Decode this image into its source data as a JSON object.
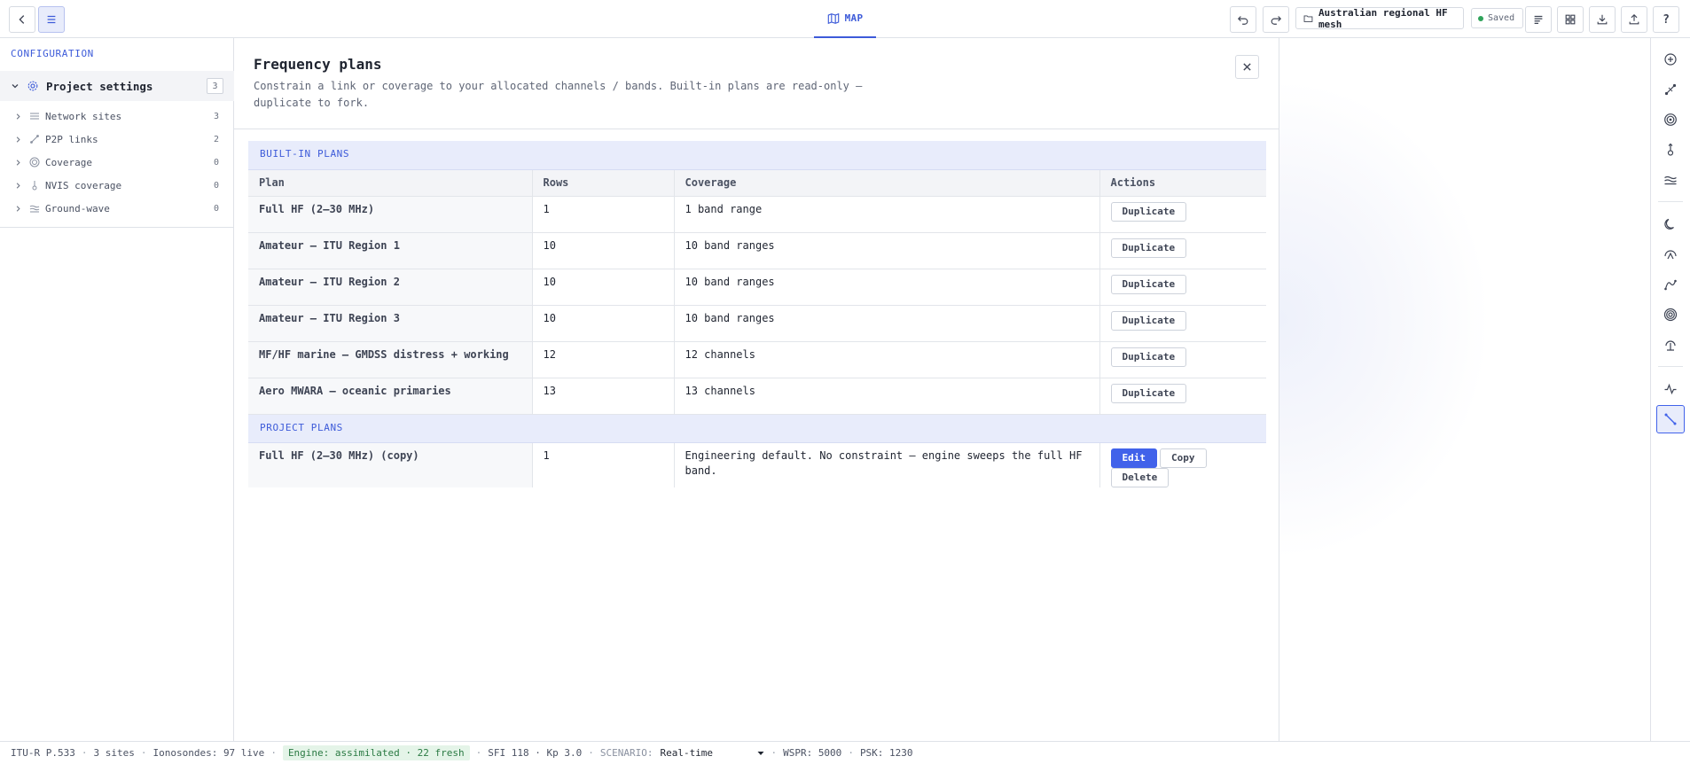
{
  "topbar": {
    "map_tab": "MAP",
    "project_name": "Australian regional HF mesh",
    "saved_status": "Saved",
    "help": "?"
  },
  "sidebar": {
    "title": "CONFIGURATION",
    "project": {
      "label": "Project settings",
      "count": "3"
    },
    "items": [
      {
        "label": "Network sites",
        "count": "3",
        "icon": "network-sites-icon"
      },
      {
        "label": "P2P links",
        "count": "2",
        "icon": "p2p-link-icon"
      },
      {
        "label": "Coverage",
        "count": "0",
        "icon": "coverage-icon"
      },
      {
        "label": "NVIS coverage",
        "count": "0",
        "icon": "nvis-icon"
      },
      {
        "label": "Ground-wave",
        "count": "0",
        "icon": "ground-wave-icon"
      }
    ]
  },
  "panel": {
    "title": "Frequency plans",
    "description": "Constrain a link or coverage to your allocated channels / bands. Built-in plans are read-only — duplicate to fork.",
    "builtin_section": "BUILT-IN PLANS",
    "project_section": "PROJECT PLANS",
    "columns": {
      "plan": "Plan",
      "rows": "Rows",
      "coverage": "Coverage",
      "actions": "Actions"
    },
    "builtin_plans": [
      {
        "plan": "Full HF (2–30 MHz)",
        "rows": "1",
        "coverage": "1 band range",
        "action": "Duplicate"
      },
      {
        "plan": "Amateur — ITU Region 1",
        "rows": "10",
        "coverage": "10 band ranges",
        "action": "Duplicate"
      },
      {
        "plan": "Amateur — ITU Region 2",
        "rows": "10",
        "coverage": "10 band ranges",
        "action": "Duplicate"
      },
      {
        "plan": "Amateur — ITU Region 3",
        "rows": "10",
        "coverage": "10 band ranges",
        "action": "Duplicate"
      },
      {
        "plan": "MF/HF marine — GMDSS distress + working",
        "rows": "12",
        "coverage": "12 channels",
        "action": "Duplicate"
      },
      {
        "plan": "Aero MWARA — oceanic primaries",
        "rows": "13",
        "coverage": "13 channels",
        "action": "Duplicate"
      }
    ],
    "project_plans": [
      {
        "plan": "Full HF (2–30 MHz) (copy)",
        "rows": "1",
        "coverage": "Engineering default. No constraint — engine sweeps the full HF band.",
        "edit": "Edit",
        "copy": "Copy",
        "delete": "Delete"
      }
    ]
  },
  "statusbar": {
    "model": "ITU-R P.533",
    "sites": "3 sites",
    "ionosondes": "Ionosondes: 97 live",
    "engine": "Engine: assimilated · 22 fresh",
    "sfi_kp": "SFI 118 · Kp 3.0",
    "scenario_label": "SCENARIO:",
    "scenario_value": "Real-time",
    "wspr": "WSPR: 5000",
    "psk": "PSK: 1230"
  },
  "colors": {
    "accent": "#4162ea",
    "section_bg": "#e8ecfb",
    "engine_ok": "#2a7a43"
  }
}
